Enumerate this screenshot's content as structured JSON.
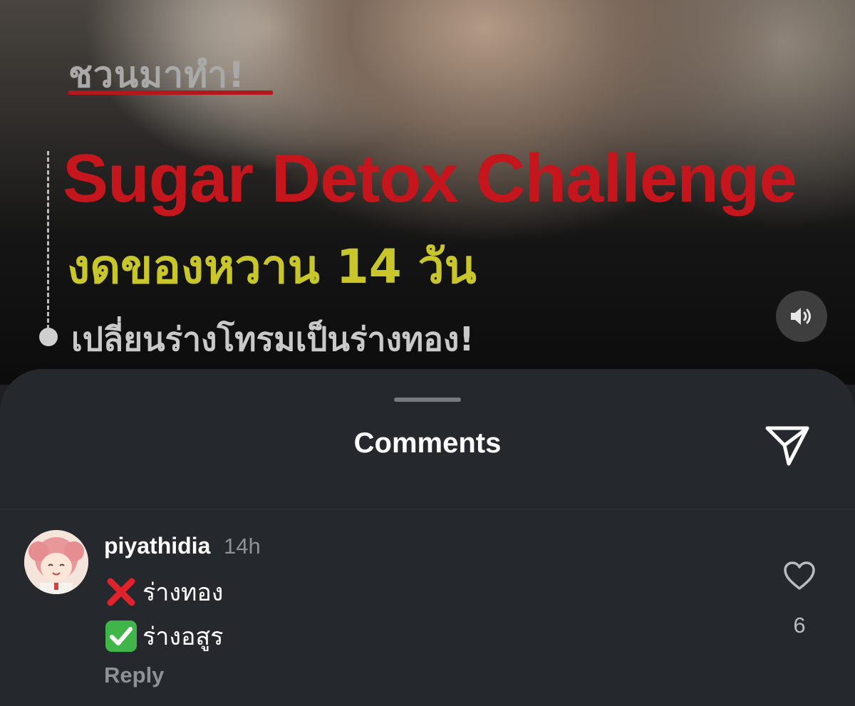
{
  "video": {
    "kicker": "ชวนมาทำ!",
    "title_en": "Sugar Detox Challenge",
    "title_th": "งดของหวาน 14 วัน",
    "subtitle_th": "เปลี่ยนร่างโทรมเป็นร่างทอง!",
    "volume_icon": "speaker-icon",
    "colors": {
      "title_en": "#c4161c",
      "title_th": "#c8c62a",
      "kicker_underline": "#b3191c"
    }
  },
  "sheet": {
    "title": "Comments",
    "share_icon": "paper-plane-icon"
  },
  "comments": [
    {
      "username": "piyathidia",
      "time": "14h",
      "lines": [
        {
          "icon": "cross-mark-icon",
          "text": "ร่างทอง"
        },
        {
          "icon": "check-mark-icon",
          "text": "ร่างอสูร"
        }
      ],
      "reply_label": "Reply",
      "like_icon": "heart-icon",
      "like_count": "6"
    }
  ]
}
